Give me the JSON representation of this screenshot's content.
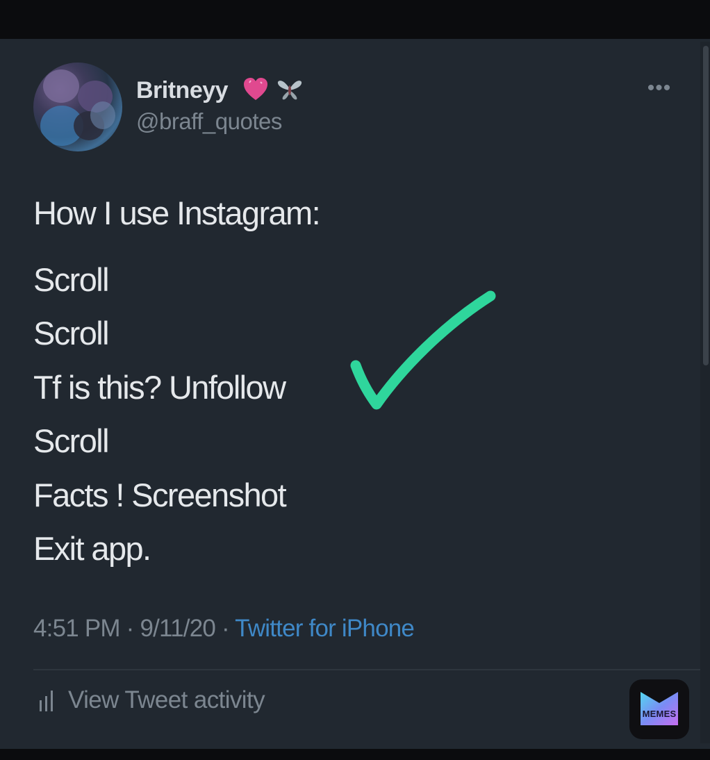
{
  "tweet": {
    "display_name": "Britneyy",
    "name_emojis": [
      "pink-heart-icon",
      "fairy-butterfly-icon"
    ],
    "username": "@braff_quotes",
    "more_label": "•••",
    "text_lines": [
      "How I use Instagram:",
      "Scroll",
      "Scroll",
      "Tf is this? Unfollow",
      "Scroll",
      "Facts ! Screenshot",
      "Exit app."
    ],
    "time": "4:51 PM",
    "separator": " · ",
    "date": "9/11/20",
    "source": "Twitter for iPhone",
    "activity_label": "View Tweet activity"
  },
  "overlay": {
    "checkmark_color": "#2fd69c",
    "watermark_text": "MEMES"
  },
  "colors": {
    "card_background": "#212830",
    "text_primary": "#e5e8eb",
    "text_muted": "#7c8690",
    "link_blue": "#3f88c7"
  }
}
